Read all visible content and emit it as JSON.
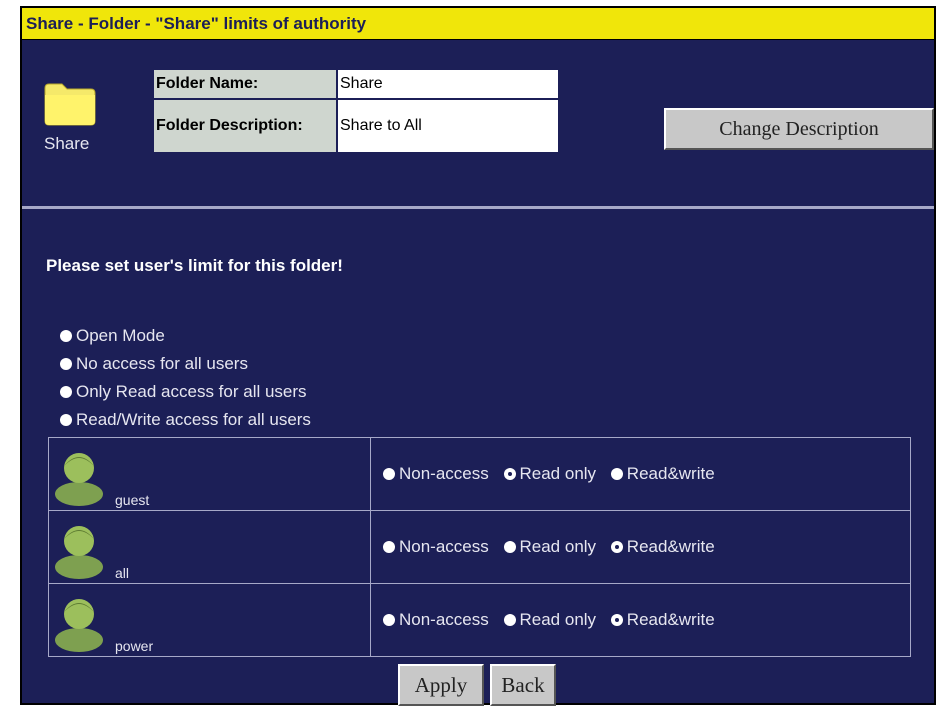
{
  "title": "Share - Folder - \"Share\" limits of authority",
  "folder": {
    "icon_name": "folder-icon",
    "label": "Share",
    "name_label": "Folder Name:",
    "name_value": "Share",
    "desc_label": "Folder Description:",
    "desc_value": "Share to All"
  },
  "change_description_label": "Change Description",
  "prompt": "Please set user's limit for this folder!",
  "modes": [
    {
      "label": "Open Mode",
      "selected": false
    },
    {
      "label": "No access for all users",
      "selected": false
    },
    {
      "label": "Only Read access for all users",
      "selected": false
    },
    {
      "label": "Read/Write access for all users",
      "selected": false
    }
  ],
  "permission_labels": [
    "Non-access",
    "Read only",
    "Read&write"
  ],
  "users": [
    {
      "name": "guest",
      "selected": "Read only"
    },
    {
      "name": "all",
      "selected": "Read&write"
    },
    {
      "name": "power",
      "selected": "Read&write"
    }
  ],
  "apply_label": "Apply",
  "back_label": "Back",
  "colors": {
    "background": "#1c1f57",
    "titlebar": "#f0e60a",
    "label_cell": "#cfd6cf"
  }
}
